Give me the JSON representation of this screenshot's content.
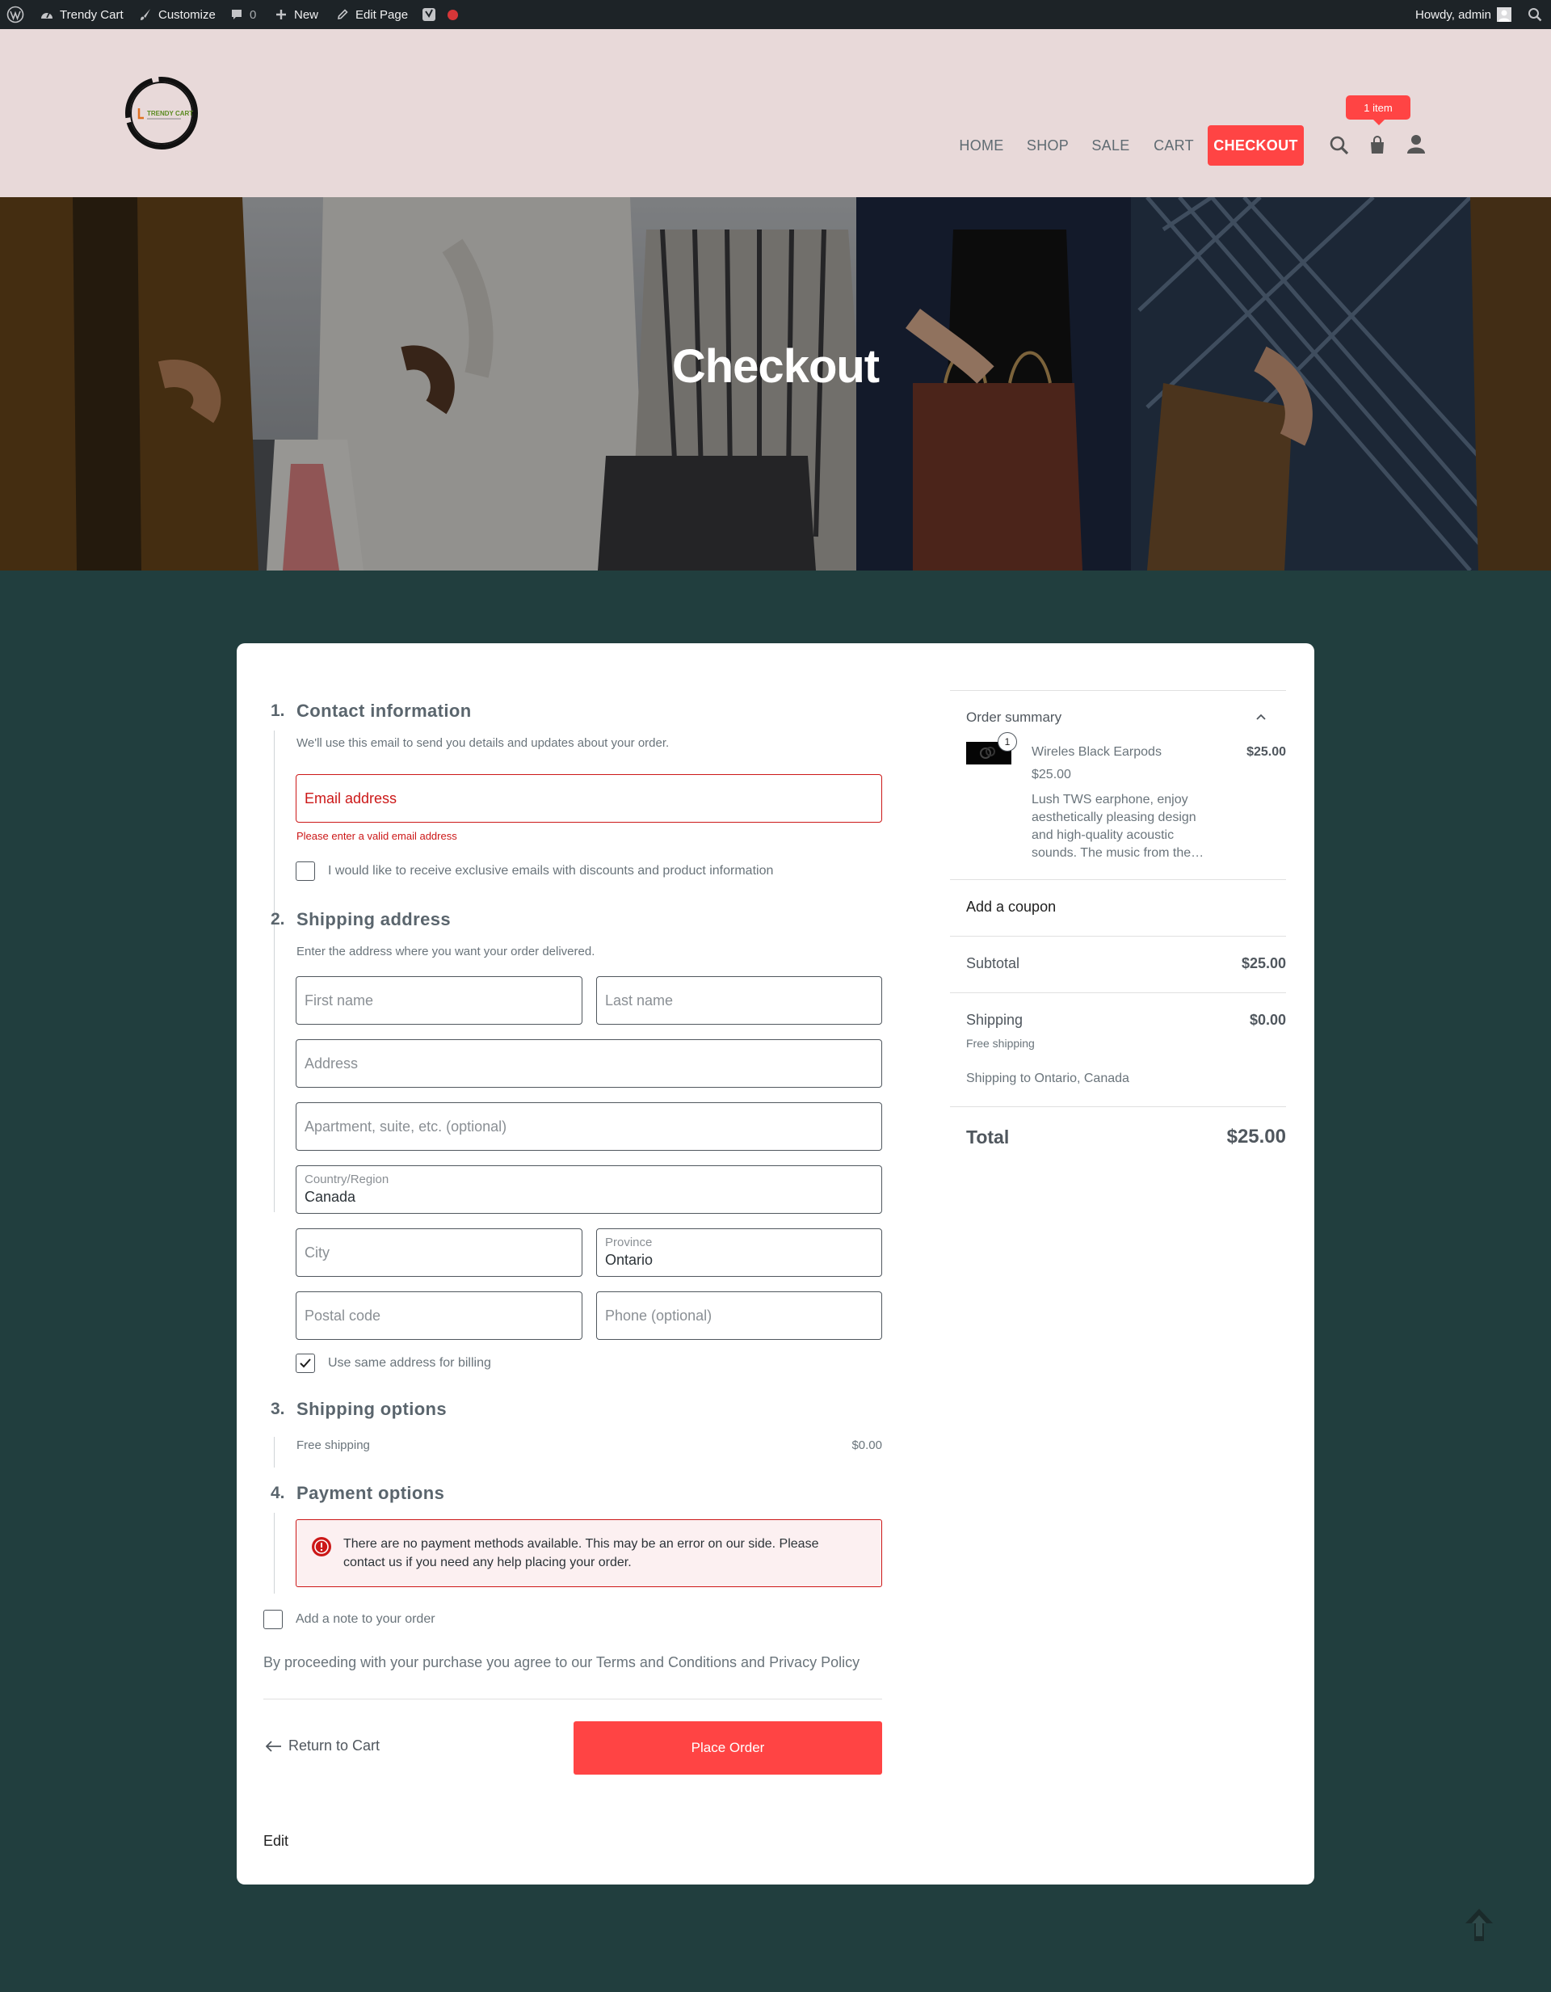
{
  "adminbar": {
    "site_name": "Trendy Cart",
    "customize": "Customize",
    "comments_count": "0",
    "new": "New",
    "edit_page": "Edit Page",
    "howdy": "Howdy, admin"
  },
  "header": {
    "logo_text": "TRENDY CART",
    "nav": [
      "HOME",
      "SHOP",
      "SALE",
      "CART",
      "CHECKOUT"
    ],
    "active_nav": "CHECKOUT",
    "cart_badge": "1 item",
    "accent_color": "#ff4444",
    "header_bg": "#e8d9d9"
  },
  "hero": {
    "title": "Checkout"
  },
  "checkout": {
    "contact": {
      "number": "1.",
      "title": "Contact information",
      "description": "We'll use this email to send you details and updates about your order.",
      "email_placeholder": "Email address",
      "email_error": "Please enter a valid email address",
      "newsletter_label": "I would like to receive exclusive emails with discounts and product information"
    },
    "shipping": {
      "number": "2.",
      "title": "Shipping address",
      "description": "Enter the address where you want your order delivered.",
      "first_name": "First name",
      "last_name": "Last name",
      "address": "Address",
      "apartment": "Apartment, suite, etc. (optional)",
      "country_label": "Country/Region",
      "country_value": "Canada",
      "city": "City",
      "province_label": "Province",
      "province_value": "Ontario",
      "postal": "Postal code",
      "phone": "Phone (optional)",
      "same_billing": "Use same address for billing"
    },
    "shipping_options": {
      "number": "3.",
      "title": "Shipping options",
      "option": "Free shipping",
      "price": "$0.00"
    },
    "payment": {
      "number": "4.",
      "title": "Payment options",
      "notice": "There are no payment methods available. This may be an error on our side. Please contact us if you need any help placing your order."
    },
    "note_label": "Add a note to your order",
    "terms_prefix": "By proceeding with your purchase you agree to our ",
    "terms_link": "Terms and Conditions",
    "terms_and": " and ",
    "privacy_link": "Privacy Policy",
    "return_label": "Return to Cart",
    "place_order": "Place Order",
    "edit": "Edit"
  },
  "summary": {
    "title": "Order summary",
    "item": {
      "qty": "1",
      "name": "Wireles Black Earpods",
      "price": "$25.00",
      "unit_price": "$25.00",
      "description": "Lush TWS earphone, enjoy aesthetically pleasing design and high-quality acoustic sounds. The music from the…"
    },
    "coupon": "Add a coupon",
    "subtotal_label": "Subtotal",
    "subtotal_value": "$25.00",
    "shipping_label": "Shipping",
    "shipping_value": "$0.00",
    "shipping_method": "Free shipping",
    "shipping_to": "Shipping to Ontario, Canada",
    "total_label": "Total",
    "total_value": "$25.00"
  }
}
